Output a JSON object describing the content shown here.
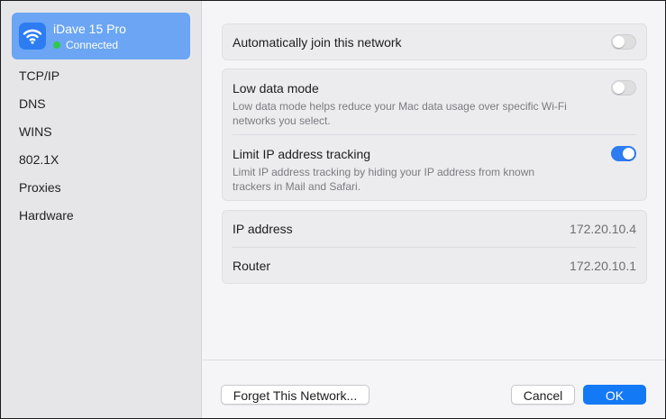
{
  "sidebar": {
    "network": {
      "name": "iDave 15 Pro",
      "status": "Connected",
      "icon": "wifi-icon"
    },
    "items": [
      {
        "label": "TCP/IP"
      },
      {
        "label": "DNS"
      },
      {
        "label": "WINS"
      },
      {
        "label": "802.1X"
      },
      {
        "label": "Proxies"
      },
      {
        "label": "Hardware"
      }
    ]
  },
  "settings": {
    "auto_join": {
      "label": "Automatically join this network",
      "enabled": false
    },
    "low_data": {
      "label": "Low data mode",
      "description": "Low data mode helps reduce your Mac data usage over specific Wi-Fi networks you select.",
      "enabled": false
    },
    "limit_ip": {
      "label": "Limit IP address tracking",
      "description": "Limit IP address tracking by hiding your IP address from known trackers in Mail and Safari.",
      "enabled": true
    }
  },
  "info": {
    "ip_label": "IP address",
    "ip_value": "172.20.10.4",
    "router_label": "Router",
    "router_value": "172.20.10.1"
  },
  "footer": {
    "forget_label": "Forget This Network...",
    "cancel_label": "Cancel",
    "ok_label": "OK"
  },
  "colors": {
    "accent": "#2d7cf2",
    "selected_card": "#6ba5f3",
    "connected_dot": "#2ec94c"
  }
}
